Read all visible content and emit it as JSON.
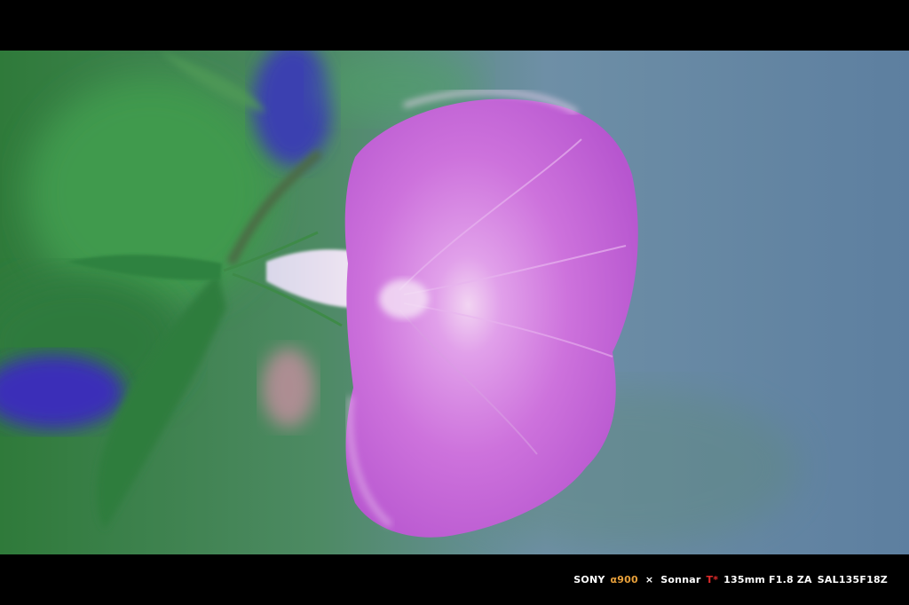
{
  "caption": {
    "brand": "SONY",
    "model": "α900",
    "separator": "×",
    "lens_name": "Sonnar",
    "lens_mark": "T*",
    "lens_spec": "135mm F1.8 ZA",
    "lens_code": "SAL135F18Z"
  },
  "colors": {
    "alpha": "#e8a03a",
    "tstar": "#e02b2b",
    "caption_text": "#ffffff",
    "background_blue": "#6a8aa7",
    "flower_pink": "#c86ad8"
  }
}
